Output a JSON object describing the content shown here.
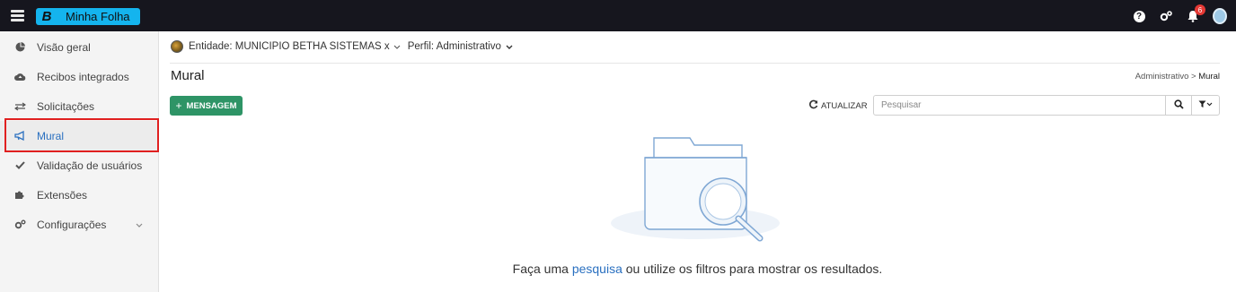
{
  "app": {
    "brand_letter": "B",
    "brand_name": "Minha Folha",
    "notification_count": "6"
  },
  "sidebar": {
    "items": [
      {
        "label": "Visão geral",
        "icon": "pie-chart-icon"
      },
      {
        "label": "Recibos integrados",
        "icon": "cloud-upload-icon"
      },
      {
        "label": "Solicitações",
        "icon": "exchange-arrows-icon"
      },
      {
        "label": "Mural",
        "icon": "megaphone-icon",
        "active": true
      },
      {
        "label": "Validação de usuários",
        "icon": "checkmark-icon"
      },
      {
        "label": "Extensões",
        "icon": "puzzle-icon"
      },
      {
        "label": "Configurações",
        "icon": "gears-icon",
        "has_submenu": true
      }
    ]
  },
  "context": {
    "entity_label": "Entidade: MUNICIPIO BETHA SISTEMAS x",
    "profile_label": "Perfil: Administrativo"
  },
  "page": {
    "title": "Mural",
    "breadcrumb_parent": "Administrativo",
    "breadcrumb_sep": ">",
    "breadcrumb_current": "Mural"
  },
  "toolbar": {
    "new_message_plus": "+",
    "new_message_label": "MENSAGEM",
    "refresh_label": "ATUALIZAR",
    "search_placeholder": "Pesquisar"
  },
  "empty_state": {
    "text_before": "Faça uma",
    "link_text": "pesquisa",
    "text_after": "ou utilize os filtros para mostrar os resultados."
  },
  "colors": {
    "topbar": "#16161e",
    "brand": "#14b4ee",
    "primary_button": "#2e9466",
    "active_link": "#2a70c0",
    "highlight": "#e02020",
    "badge": "#e53935"
  }
}
